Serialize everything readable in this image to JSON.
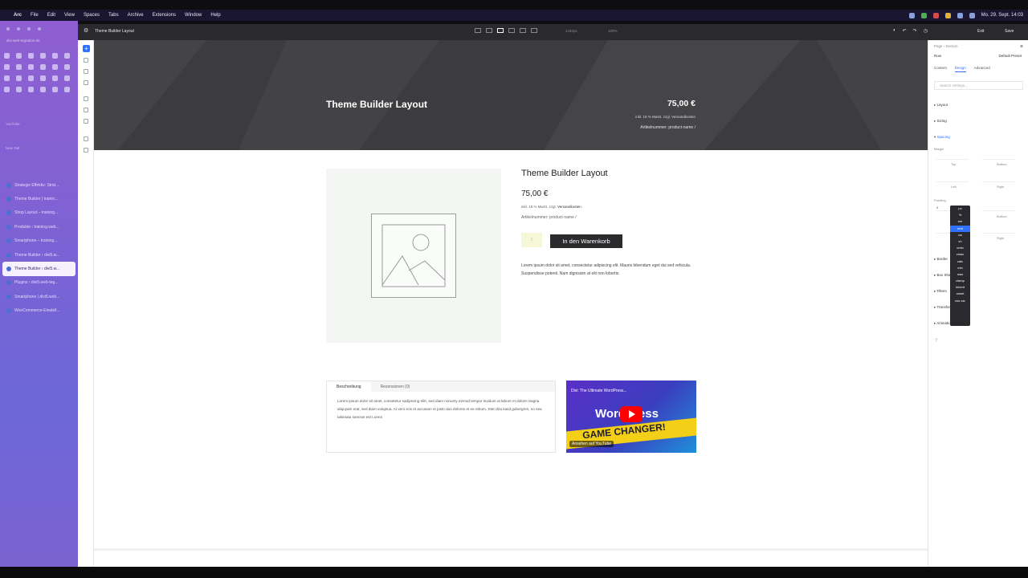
{
  "menubar": {
    "app": "Arc",
    "items": [
      "File",
      "Edit",
      "View",
      "Spaces",
      "Tabs",
      "Archive",
      "Extensions",
      "Window",
      "Help"
    ],
    "clock": "Mo. 29. Sept. 14:03"
  },
  "browser": {
    "url": "divi.web-tegration.de",
    "section_label": "YouTube",
    "new_tab": "New Tab",
    "tabs": [
      {
        "label": "Strategie Effektiv: Strat...",
        "active": false
      },
      {
        "label": "Theme Builder | trainin...",
        "active": false
      },
      {
        "label": "Shop Layout – training...",
        "active": false
      },
      {
        "label": "Produkte ‹ training.web...",
        "active": false
      },
      {
        "label": "Smartphone – training...",
        "active": false
      },
      {
        "label": "Theme Builder ‹ divi5.w...",
        "active": false
      },
      {
        "label": "Theme Builder ‹ divi5.w...",
        "active": true
      },
      {
        "label": "Plugins ‹ divi5.web-teg...",
        "active": false
      },
      {
        "label": "Smartphone | divi5.web...",
        "active": false
      },
      {
        "label": "WooCommerce-Einstell...",
        "active": false
      }
    ]
  },
  "builder": {
    "title": "Theme Builder Layout",
    "width_readout": "1440px",
    "zoom_readout": "100%",
    "exit_label": "Exit",
    "save_label": "Save"
  },
  "hero": {
    "title": "Theme Builder Layout",
    "price": "75,00 €",
    "vat": "inkl. 19 % MwSt. zzgl. Versandkosten",
    "sku": "Artikelnummer: product-name /"
  },
  "product": {
    "title": "Theme Builder Layout",
    "price": "75,00 €",
    "vat_prefix": "inkl. 19 % MwSt. zzgl. ",
    "vat_link": "Versandkosten",
    "sku": "Artikelnummer: product-name /",
    "qty": "1",
    "cart_label": "In den Warenkorb",
    "description": "Lorem ipsum dolor sit amet, consectetur adipiscing elit. Mauris bibendum eget dui sed vehicula. Suspendisse potenti. Nam dignissim at elit non lobortis."
  },
  "tabs": {
    "items": [
      "Beschreibung",
      "Rezensionen (0)"
    ],
    "body": "Lorem ipsum dolor sit amet, consetetur sadipscing elitr, sed diam nonumy eirmod tempor invidunt ut labore et dolore magna aliquyam erat, sed diam voluptua. At vero eos et accusam et justo duo dolores et ea rebum. Stet clita kasd gubergren, no sea takimata sanctus est Lorem"
  },
  "video": {
    "title": "Divi: The Ultimate WordPress...",
    "headline": "WordPress",
    "band_text": "GAME CHANGER!",
    "watch_label": "Ansehen auf YouTube"
  },
  "panel": {
    "breadcrumb": "Page › Section",
    "element": "Row",
    "preset": "Default Preset",
    "tabs": [
      "Content",
      "Design",
      "Advanced"
    ],
    "active_tab": "Design",
    "search_placeholder": "Search settings...",
    "groups": [
      "Layout",
      "Sizing",
      "Spacing",
      "Border",
      "Box Shadow",
      "Filters",
      "Transform",
      "Animation"
    ],
    "margin_label": "Margin",
    "padding_label": "Padding",
    "side_labels": [
      "Top",
      "Bottom",
      "Left",
      "Right"
    ],
    "padding_top_value": "2",
    "units": [
      "px",
      "%",
      "em",
      "rem",
      "vw",
      "vh",
      "vmin",
      "vmax",
      "calc",
      "min",
      "max",
      "clamp",
      "inherit",
      "unset",
      "css var"
    ],
    "selected_unit": "rem"
  }
}
